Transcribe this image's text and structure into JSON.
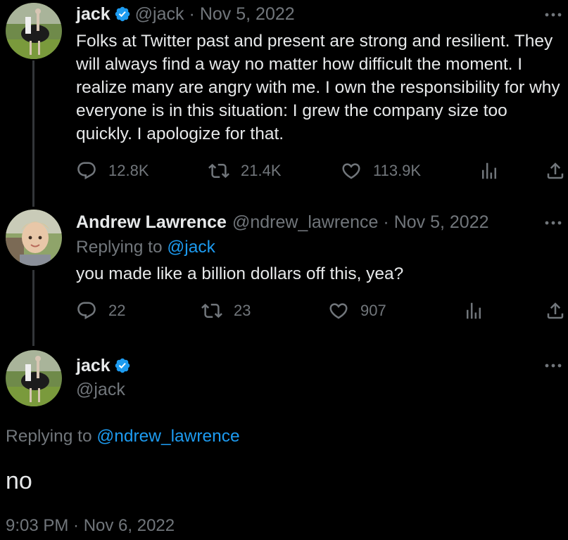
{
  "tweets": [
    {
      "name": "jack",
      "handle": "@jack",
      "separator": "·",
      "date": "Nov 5, 2022",
      "text": "Folks at Twitter past and present are strong and resilient. They will always find a way no matter how difficult the moment. I realize many are angry with me. I own the responsibility for why everyone is in this situation: I grew the company size too quickly. I apologize for that.",
      "replies": "12.8K",
      "retweets": "21.4K",
      "likes": "113.9K"
    },
    {
      "name": "Andrew Lawrence",
      "handle": "@ndrew_lawrence",
      "separator": "·",
      "date": "Nov 5, 2022",
      "replying_label": "Replying to",
      "replying_to": "@jack",
      "text": "you made like a billion dollars off this, yea?",
      "replies": "22",
      "retweets": "23",
      "likes": "907"
    }
  ],
  "main_tweet": {
    "name": "jack",
    "handle": "@jack",
    "replying_label": "Replying to",
    "replying_to": "@ndrew_lawrence",
    "text": "no",
    "timestamp": "9:03 PM · Nov 6, 2022"
  },
  "icons": {
    "reply": "reply-icon",
    "retweet": "retweet-icon",
    "like": "like-icon",
    "views": "views-icon",
    "share": "share-icon",
    "more": "more-icon",
    "verified": "verified-badge-icon"
  },
  "colors": {
    "background": "#000000",
    "text": "#e7e9ea",
    "muted": "#71767b",
    "accent": "#1d9bf0",
    "thread_line": "#333639"
  }
}
